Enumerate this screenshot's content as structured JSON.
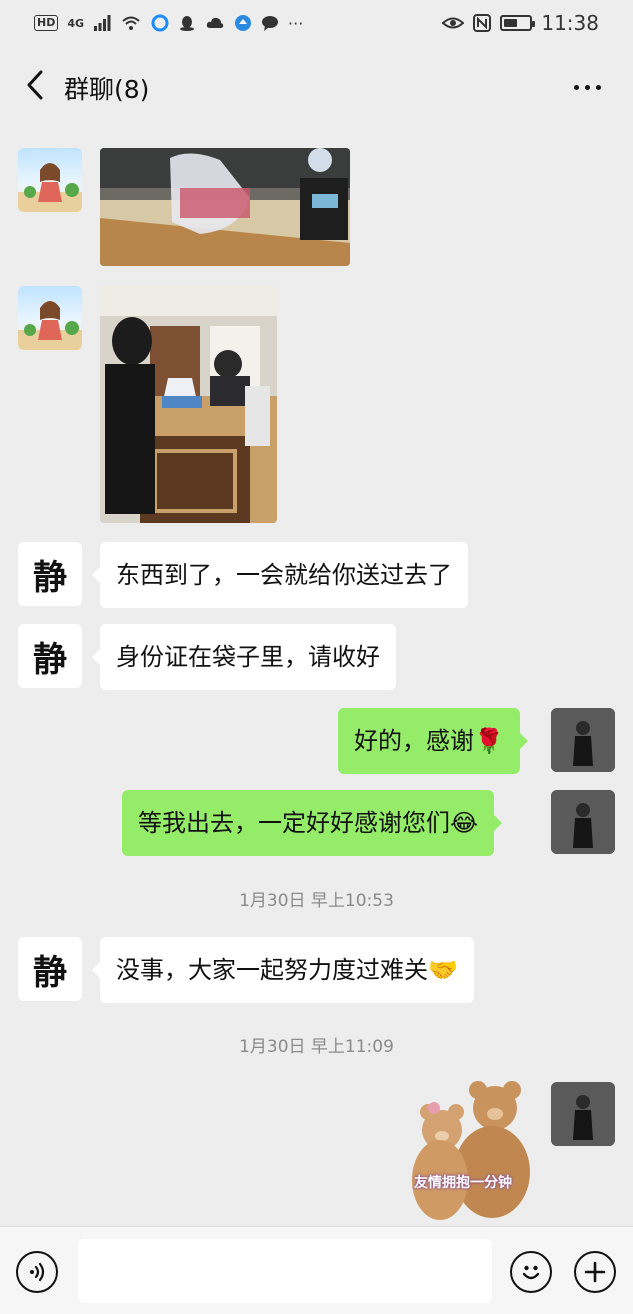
{
  "status_bar": {
    "hd": "HD",
    "signal": "4G",
    "time": "11:38",
    "more": "···"
  },
  "nav": {
    "title": "群聊(8)"
  },
  "messages": [
    {
      "type": "image",
      "side": "left",
      "avatar": "girl-cartoon"
    },
    {
      "type": "image",
      "side": "left",
      "avatar": "girl-cartoon"
    },
    {
      "type": "text",
      "side": "left",
      "avatar": "jing",
      "text": "东西到了，一会就给你送过去了"
    },
    {
      "type": "text",
      "side": "left",
      "avatar": "jing",
      "text": "身份证在袋子里，请收好"
    },
    {
      "type": "text",
      "side": "right",
      "avatar": "me",
      "text": "好的，感谢🌹"
    },
    {
      "type": "text",
      "side": "right",
      "avatar": "me",
      "text": "等我出去，一定好好感谢您们😂"
    },
    {
      "type": "text",
      "side": "left",
      "avatar": "jing",
      "text": "没事，大家一起努力度过难关🤝"
    },
    {
      "type": "sticker",
      "side": "right",
      "avatar": "me",
      "text": "友情拥抱一分钟"
    }
  ],
  "avatar_jing_char": "静",
  "timestamps": [
    "1月30日 早上10:53",
    "1月30日 早上11:09"
  ],
  "input": {
    "value": ""
  },
  "colors": {
    "background": "#ededed",
    "self_bubble": "#95ec69",
    "other_bubble": "#ffffff",
    "timestamp": "#8a8a8a"
  }
}
